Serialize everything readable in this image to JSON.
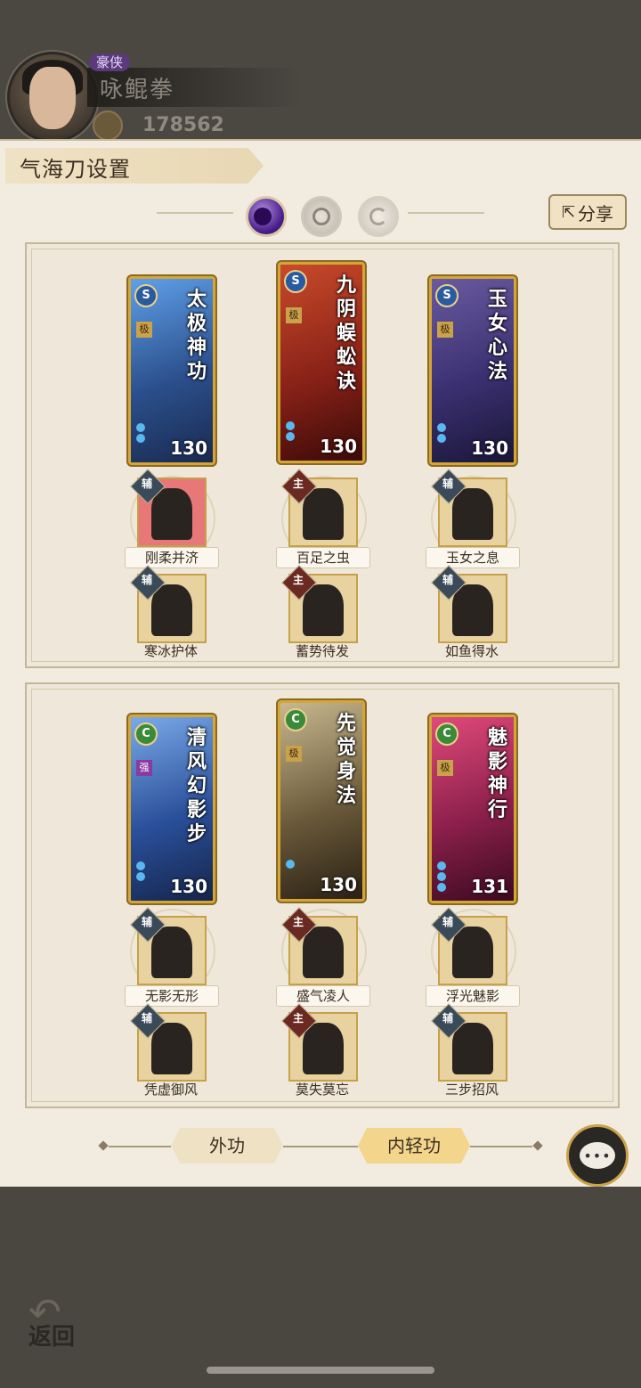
{
  "header": {
    "rank_badge": "豪侠",
    "player_name": "咏鲲拳",
    "power": "178562"
  },
  "panel": {
    "title": "气海刀设置",
    "share_label": "分享",
    "share_icon": "share-icon"
  },
  "section_one": {
    "cards": [
      {
        "name": "太极神功",
        "rank": "极",
        "level": "130",
        "badge": "S",
        "color": "#2b4f8c"
      },
      {
        "name": "九阴蜈蚣诀",
        "rank": "极",
        "level": "130",
        "badge": "S",
        "color": "#8a2218"
      },
      {
        "name": "玉女心法",
        "rank": "极",
        "level": "130",
        "badge": "S",
        "color": "#3a3070"
      }
    ],
    "skills_row1": [
      {
        "tag": "辅",
        "label": "刚柔并济",
        "main": false
      },
      {
        "tag": "主",
        "label": "百足之虫",
        "main": true
      },
      {
        "tag": "辅",
        "label": "玉女之息",
        "main": false
      }
    ],
    "skills_row2": [
      {
        "tag": "辅",
        "label": "寒冰护体",
        "main": false
      },
      {
        "tag": "主",
        "label": "蓄势待发",
        "main": true
      },
      {
        "tag": "辅",
        "label": "如鱼得水",
        "main": false
      }
    ]
  },
  "section_two": {
    "cards": [
      {
        "name": "清风幻影步",
        "rank": "强",
        "level": "130",
        "badge": "C",
        "color": "#2a4f9a"
      },
      {
        "name": "先觉身法",
        "rank": "极",
        "level": "130",
        "badge": "C",
        "color": "#6a5a3a"
      },
      {
        "name": "魅影神行",
        "rank": "极",
        "level": "131",
        "badge": "C",
        "color": "#8a1f4a"
      }
    ],
    "skills_row1": [
      {
        "tag": "辅",
        "label": "无影无形",
        "main": false
      },
      {
        "tag": "主",
        "label": "盛气凌人",
        "main": true
      },
      {
        "tag": "辅",
        "label": "浮光魅影",
        "main": false
      }
    ],
    "skills_row2": [
      {
        "tag": "辅",
        "label": "凭虚御风",
        "main": false
      },
      {
        "tag": "主",
        "label": "莫失莫忘",
        "main": true
      },
      {
        "tag": "辅",
        "label": "三步招风",
        "main": false
      }
    ]
  },
  "bottom_tabs": {
    "outer": "外功",
    "inner": "内轻功"
  },
  "chat_icon": "chat-icon",
  "back_label": "返回"
}
